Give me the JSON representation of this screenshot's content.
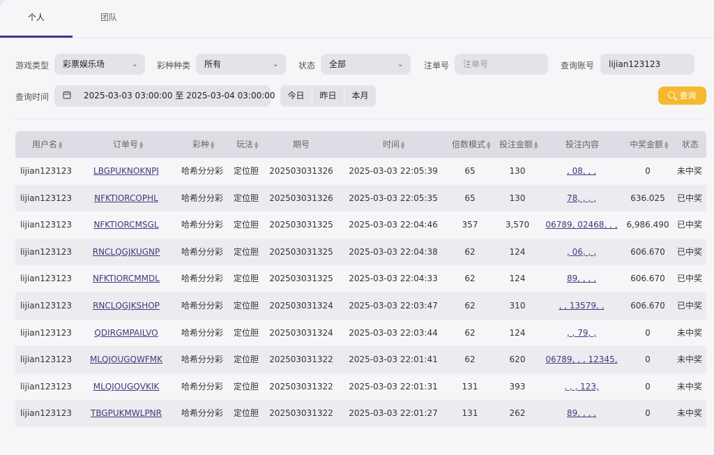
{
  "tabs": [
    {
      "label": "个人",
      "active": true
    },
    {
      "label": "团队",
      "active": false
    }
  ],
  "filters": {
    "game_type_label": "游戏类型",
    "game_type_value": "彩票娱乐场",
    "lottery_kind_label": "彩种种类",
    "lottery_kind_value": "所有",
    "status_label": "状态",
    "status_value": "全部",
    "order_no_label": "注单号",
    "order_no_placeholder": "注单号",
    "account_label": "查询账号",
    "account_value": "lijian123123",
    "time_label": "查询时间",
    "time_range": "2025-03-03 03:00:00 至 2025-03-04 03:00:00",
    "quick": [
      "今日",
      "昨日",
      "本月"
    ],
    "search_label": "查询"
  },
  "table": {
    "headers": [
      "用户名",
      "订单号",
      "彩种",
      "玩法",
      "期号",
      "时间",
      "倍数模式",
      "投注金额",
      "投注内容",
      "中奖金额",
      "状态"
    ],
    "rows": [
      {
        "user": "lijian123123",
        "order": "LBGPUKNOKNPJ",
        "kind": "哈希分分彩",
        "play": "定位胆",
        "issue": "202503031326",
        "time": "2025-03-03 22:05:39",
        "mult": "65",
        "amount": "130",
        "content": ", 08, , ,",
        "win": "0",
        "status": "未中奖"
      },
      {
        "user": "lijian123123",
        "order": "NFKTIORCOPHL",
        "kind": "哈希分分彩",
        "play": "定位胆",
        "issue": "202503031326",
        "time": "2025-03-03 22:05:35",
        "mult": "65",
        "amount": "130",
        "content": "78, , , ,",
        "win": "636.025",
        "status": "已中奖"
      },
      {
        "user": "lijian123123",
        "order": "NFKTIORCMSGL",
        "kind": "哈希分分彩",
        "play": "定位胆",
        "issue": "202503031325",
        "time": "2025-03-03 22:04:46",
        "mult": "357",
        "amount": "3,570",
        "content": "06789, 02468, , ,",
        "win": "6,986.490",
        "status": "已中奖"
      },
      {
        "user": "lijian123123",
        "order": "RNCLQGJKUGNP",
        "kind": "哈希分分彩",
        "play": "定位胆",
        "issue": "202503031325",
        "time": "2025-03-03 22:04:38",
        "mult": "62",
        "amount": "124",
        "content": ", 06, , ,",
        "win": "606.670",
        "status": "已中奖"
      },
      {
        "user": "lijian123123",
        "order": "NFKTIORCMMDL",
        "kind": "哈希分分彩",
        "play": "定位胆",
        "issue": "202503031325",
        "time": "2025-03-03 22:04:33",
        "mult": "62",
        "amount": "124",
        "content": "89, , , ,",
        "win": "606.670",
        "status": "已中奖"
      },
      {
        "user": "lijian123123",
        "order": "RNCLQGJKSHOP",
        "kind": "哈希分分彩",
        "play": "定位胆",
        "issue": "202503031324",
        "time": "2025-03-03 22:03:47",
        "mult": "62",
        "amount": "310",
        "content": ", , 13579, ,",
        "win": "606.670",
        "status": "已中奖"
      },
      {
        "user": "lijian123123",
        "order": "QDIRGMPAILVO",
        "kind": "哈希分分彩",
        "play": "定位胆",
        "issue": "202503031324",
        "time": "2025-03-03 22:03:44",
        "mult": "62",
        "amount": "124",
        "content": ", , 79, ,",
        "win": "0",
        "status": "未中奖"
      },
      {
        "user": "lijian123123",
        "order": "MLQJOUGQWFMK",
        "kind": "哈希分分彩",
        "play": "定位胆",
        "issue": "202503031322",
        "time": "2025-03-03 22:01:41",
        "mult": "62",
        "amount": "620",
        "content": "06789, , , 12345,",
        "win": "0",
        "status": "未中奖"
      },
      {
        "user": "lijian123123",
        "order": "MLQJOUGQVKIK",
        "kind": "哈希分分彩",
        "play": "定位胆",
        "issue": "202503031322",
        "time": "2025-03-03 22:01:31",
        "mult": "131",
        "amount": "393",
        "content": ", , , 123,",
        "win": "0",
        "status": "未中奖"
      },
      {
        "user": "lijian123123",
        "order": "TBGPUKMWLPNR",
        "kind": "哈希分分彩",
        "play": "定位胆",
        "issue": "202503031322",
        "time": "2025-03-03 22:01:27",
        "mult": "131",
        "amount": "262",
        "content": "89, , , ,",
        "win": "0",
        "status": "未中奖"
      }
    ]
  },
  "colors": {
    "accent": "#3b3591",
    "search": "#f5b82e"
  }
}
